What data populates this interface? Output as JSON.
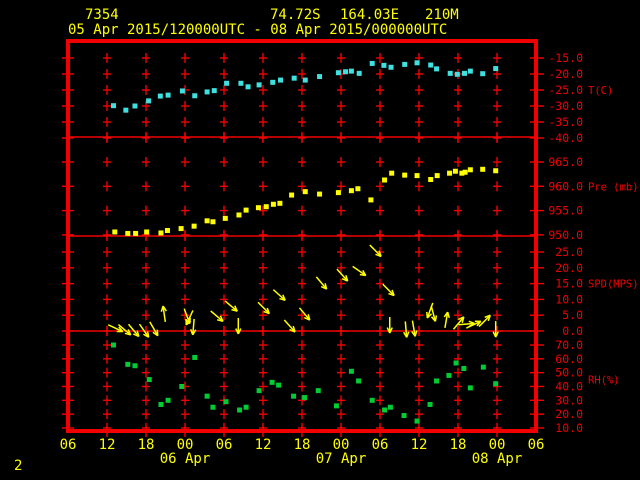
{
  "header": {
    "station_id": "7354",
    "latitude": "74.72S",
    "longitude": "164.03E",
    "elevation": "210M",
    "period": "05 Apr 2015/120000UTC - 08 Apr 2015/000000UTC"
  },
  "page_number": "2",
  "colors": {
    "background": "#000000",
    "axis": "#f20000",
    "label_text": "#f20000",
    "header_text": "#ffff00",
    "time_text": "#ffff00",
    "temperature": "#3fe0e0",
    "pressure": "#ffff00",
    "wind": "#ffff00",
    "humidity": "#00cc33"
  },
  "time_axis": {
    "span_hours": 72,
    "tick_step_hours": 6,
    "tick_labels": [
      "06",
      "12",
      "18",
      "00",
      "06",
      "12",
      "18",
      "00",
      "06",
      "12",
      "18",
      "00",
      "06"
    ],
    "date_labels": [
      {
        "hour": 18,
        "label": "06 Apr"
      },
      {
        "hour": 42,
        "label": "07 Apr"
      },
      {
        "hour": 66,
        "label": "08 Apr"
      }
    ]
  },
  "chart_data": [
    {
      "type": "scatter",
      "name": "temperature",
      "unit_label": "T(C)",
      "yticks": [
        -15,
        -20,
        -25,
        -30,
        -35,
        -40
      ],
      "ytick_labels": [
        "-15.0",
        "-20.0",
        "-25.0",
        "-30.0",
        "-35.0",
        "-40.0"
      ],
      "points": [
        [
          7.0,
          -29.9
        ],
        [
          8.9,
          -31.3
        ],
        [
          10.3,
          -30.0
        ],
        [
          12.4,
          -28.4
        ],
        [
          14.2,
          -26.9
        ],
        [
          15.4,
          -26.6
        ],
        [
          17.6,
          -25.3
        ],
        [
          19.5,
          -26.8
        ],
        [
          21.4,
          -25.6
        ],
        [
          22.5,
          -25.2
        ],
        [
          24.4,
          -22.9
        ],
        [
          26.6,
          -22.9
        ],
        [
          27.7,
          -24.0
        ],
        [
          29.4,
          -23.4
        ],
        [
          31.5,
          -22.6
        ],
        [
          32.7,
          -21.9
        ],
        [
          34.8,
          -21.3
        ],
        [
          36.5,
          -21.9
        ],
        [
          38.7,
          -20.8
        ],
        [
          41.6,
          -19.6
        ],
        [
          42.7,
          -19.3
        ],
        [
          43.6,
          -19.1
        ],
        [
          44.8,
          -19.8
        ],
        [
          46.8,
          -16.7
        ],
        [
          48.6,
          -17.3
        ],
        [
          49.7,
          -17.9
        ],
        [
          51.8,
          -17.0
        ],
        [
          53.7,
          -16.5
        ],
        [
          55.8,
          -17.2
        ],
        [
          56.7,
          -18.4
        ],
        [
          58.8,
          -19.8
        ],
        [
          59.9,
          -20.1
        ],
        [
          61.0,
          -19.8
        ],
        [
          61.9,
          -19.1
        ],
        [
          63.8,
          -19.9
        ],
        [
          65.8,
          -18.3
        ]
      ]
    },
    {
      "type": "scatter",
      "name": "pressure",
      "unit_label": "Pre (mb)",
      "yticks": [
        965,
        960,
        955,
        950
      ],
      "ytick_labels": [
        "965.0",
        "960.0",
        "955.0",
        "950.0"
      ],
      "points": [
        [
          7.2,
          950.6
        ],
        [
          9.2,
          950.3
        ],
        [
          10.4,
          950.3
        ],
        [
          12.1,
          950.6
        ],
        [
          14.3,
          950.4
        ],
        [
          15.3,
          950.9
        ],
        [
          17.4,
          951.3
        ],
        [
          19.4,
          951.8
        ],
        [
          21.4,
          952.9
        ],
        [
          22.3,
          952.7
        ],
        [
          24.2,
          953.4
        ],
        [
          26.3,
          954.1
        ],
        [
          27.4,
          955.1
        ],
        [
          29.3,
          955.6
        ],
        [
          30.5,
          955.8
        ],
        [
          31.6,
          956.3
        ],
        [
          32.6,
          956.5
        ],
        [
          34.4,
          958.2
        ],
        [
          36.5,
          958.9
        ],
        [
          38.7,
          958.4
        ],
        [
          41.6,
          958.7
        ],
        [
          43.6,
          959.1
        ],
        [
          44.6,
          959.5
        ],
        [
          46.6,
          957.2
        ],
        [
          48.7,
          961.3
        ],
        [
          49.8,
          962.7
        ],
        [
          51.8,
          962.3
        ],
        [
          53.7,
          962.2
        ],
        [
          55.8,
          961.4
        ],
        [
          56.8,
          962.2
        ],
        [
          58.7,
          962.7
        ],
        [
          59.6,
          963.1
        ],
        [
          60.6,
          962.7
        ],
        [
          61.1,
          962.9
        ],
        [
          61.9,
          963.4
        ],
        [
          63.8,
          963.5
        ],
        [
          65.8,
          963.2
        ]
      ]
    },
    {
      "type": "vector",
      "name": "wind_speed",
      "unit_label": "SPD(MPS)",
      "yticks": [
        25,
        20,
        15,
        10,
        5,
        0
      ],
      "ytick_labels": [
        "25.0",
        "20.0",
        "15.0",
        "10.0",
        "5.0",
        "0.0"
      ],
      "arrows": [
        [
          7.3,
          0.9,
          25
        ],
        [
          8.7,
          0.4,
          40
        ],
        [
          10.1,
          0.2,
          50
        ],
        [
          11.7,
          0.1,
          55
        ],
        [
          13.2,
          0.7,
          60
        ],
        [
          14.8,
          5.4,
          262
        ],
        [
          18.3,
          4.7,
          70
        ],
        [
          18.7,
          4.2,
          115
        ],
        [
          19.3,
          1.3,
          95
        ],
        [
          22.9,
          4.7,
          40
        ],
        [
          25.1,
          7.9,
          40
        ],
        [
          26.2,
          1.6,
          90
        ],
        [
          30.1,
          7.3,
          45
        ],
        [
          32.5,
          11.4,
          42
        ],
        [
          34.1,
          1.6,
          48
        ],
        [
          36.4,
          5.4,
          50
        ],
        [
          39.0,
          15.2,
          50
        ],
        [
          42.2,
          17.7,
          48
        ],
        [
          44.8,
          19.0,
          35
        ],
        [
          47.3,
          25.4,
          45
        ],
        [
          49.3,
          13.0,
          45
        ],
        [
          49.5,
          1.9,
          90
        ],
        [
          52.0,
          0.5,
          85
        ],
        [
          53.2,
          0.8,
          80
        ],
        [
          55.7,
          6.5,
          110
        ],
        [
          56.2,
          5.5,
          75
        ],
        [
          58.2,
          3.5,
          280
        ],
        [
          60.1,
          2.5,
          310
        ],
        [
          61.3,
          2.2,
          355
        ],
        [
          62.4,
          2.0,
          335
        ],
        [
          64.1,
          3.2,
          315
        ],
        [
          65.8,
          0.6,
          90
        ]
      ]
    },
    {
      "type": "scatter",
      "name": "relative_humidity",
      "unit_label": "RH(%)",
      "yticks": [
        70,
        60,
        50,
        40,
        30,
        20,
        10
      ],
      "ytick_labels": [
        "70.0",
        "60.0",
        "50.0",
        "40.0",
        "30.0",
        "20.0",
        "10.0"
      ],
      "points": [
        [
          7.0,
          70
        ],
        [
          9.2,
          56
        ],
        [
          10.3,
          55
        ],
        [
          12.5,
          45
        ],
        [
          14.3,
          27
        ],
        [
          15.4,
          30
        ],
        [
          17.5,
          40
        ],
        [
          19.5,
          61
        ],
        [
          21.4,
          33
        ],
        [
          22.3,
          25
        ],
        [
          24.3,
          29
        ],
        [
          26.4,
          23
        ],
        [
          27.4,
          25
        ],
        [
          29.4,
          37
        ],
        [
          31.4,
          43
        ],
        [
          32.4,
          41
        ],
        [
          34.7,
          33
        ],
        [
          36.4,
          32
        ],
        [
          38.5,
          37
        ],
        [
          41.3,
          26
        ],
        [
          43.6,
          51
        ],
        [
          44.7,
          44
        ],
        [
          46.8,
          30
        ],
        [
          48.7,
          23
        ],
        [
          49.6,
          25
        ],
        [
          51.7,
          19
        ],
        [
          53.7,
          15
        ],
        [
          55.7,
          27
        ],
        [
          56.7,
          44
        ],
        [
          58.6,
          48
        ],
        [
          59.7,
          57
        ],
        [
          60.9,
          53
        ],
        [
          61.9,
          39
        ],
        [
          63.9,
          54
        ],
        [
          65.8,
          42
        ]
      ]
    }
  ]
}
